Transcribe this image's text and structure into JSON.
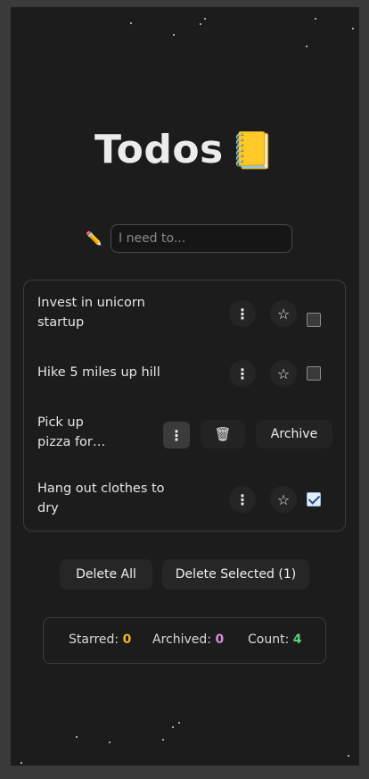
{
  "header": {
    "title": "Todos",
    "emoji": "📒"
  },
  "entry": {
    "icon": "✏️",
    "placeholder": "I need to..."
  },
  "todos": [
    {
      "text_line1": "Invest in unicorn",
      "text_line2": "startup",
      "checked": false
    },
    {
      "text_line1": "Hike 5 miles up hill",
      "text_line2": "",
      "checked": false
    },
    {
      "text_line1": "Pick up",
      "text_line2": "pizza for…",
      "checked": false
    },
    {
      "text_line1": "Hang out clothes to",
      "text_line2": "dry",
      "checked": true
    }
  ],
  "row_icons": {
    "menu": "⋮",
    "star": "☆",
    "trash": "🗑"
  },
  "expanded_row": {
    "archive_label": "Archive"
  },
  "actions": {
    "delete_all": "Delete All",
    "delete_selected": "Delete Selected (1)"
  },
  "stats": {
    "starred_label": "Starred:",
    "starred_value": "0",
    "starred_color": "#f0b429",
    "archived_label": "Archived:",
    "archived_value": "0",
    "archived_color": "#d78ad8",
    "count_label": "Count:",
    "count_value": "4",
    "count_color": "#5fd07a"
  }
}
